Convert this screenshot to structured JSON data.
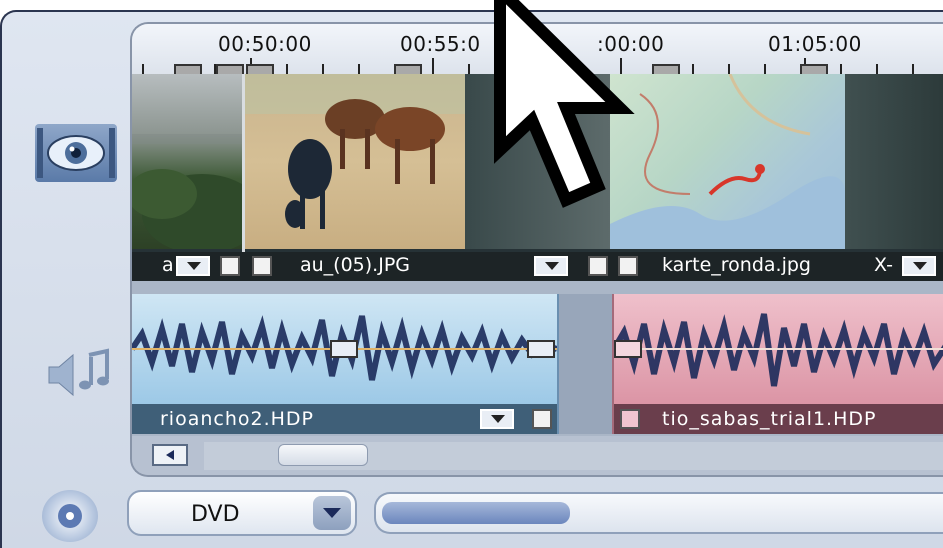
{
  "timeline": {
    "ruler_labels": [
      "00:50:00",
      "00:55:0",
      ":00:00",
      "01:05:00"
    ]
  },
  "video_track": {
    "clips": [
      {
        "label": "a",
        "kind": "landscape photo"
      },
      {
        "label": "au_(05).JPG",
        "kind": "goats photo"
      },
      {
        "label": "karte_ronda.jpg",
        "kind": "map photo"
      },
      {
        "label": "X-",
        "kind": "next clip"
      }
    ]
  },
  "audio_track": {
    "clips": [
      {
        "label": "rioancho2.HDP",
        "color": "#9fcbe6"
      },
      {
        "label": "tio_sabas_trial1.HDP",
        "color": "#d88c9c"
      }
    ]
  },
  "bottom_bar": {
    "dropdown_value": "DVD"
  },
  "icons": {
    "video_track": "eye-film-icon",
    "audio_track": "speaker-note-icon",
    "disc": "disc-icon",
    "cursor": "mouse-pointer-icon"
  }
}
